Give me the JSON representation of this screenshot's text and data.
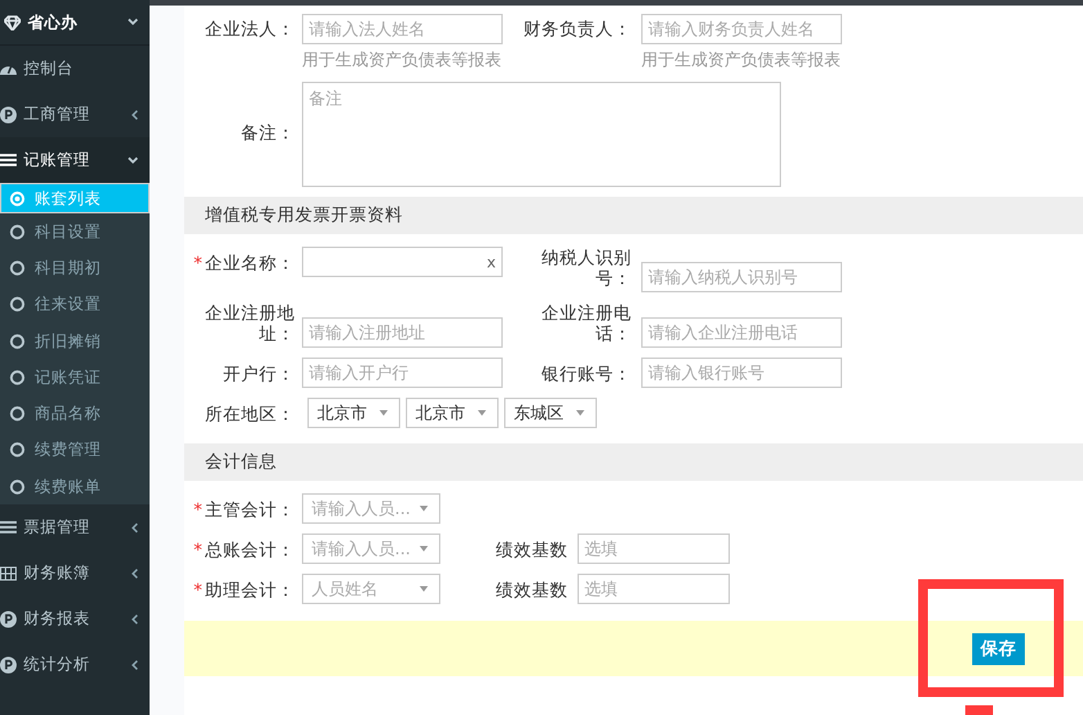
{
  "sidebar": {
    "brand": {
      "label": "省心办",
      "expanded": true
    },
    "items": [
      {
        "label": "控制台",
        "kind": "gauge"
      },
      {
        "label": "工商管理",
        "kind": "badge",
        "expanded": false
      },
      {
        "label": "记账管理",
        "kind": "list",
        "expanded": true,
        "children": [
          {
            "label": "账套列表",
            "selected": true
          },
          {
            "label": "科目设置",
            "selected": false
          },
          {
            "label": "科目期初",
            "selected": false
          },
          {
            "label": "往来设置",
            "selected": false
          },
          {
            "label": "折旧摊销",
            "selected": false
          },
          {
            "label": "记账凭证",
            "selected": false
          },
          {
            "label": "商品名称",
            "selected": false
          },
          {
            "label": "续费管理",
            "selected": false
          },
          {
            "label": "续费账单",
            "selected": false
          }
        ]
      },
      {
        "label": "票据管理",
        "kind": "list",
        "expanded": false
      },
      {
        "label": "财务账簿",
        "kind": "table",
        "expanded": false
      },
      {
        "label": "财务报表",
        "kind": "badge",
        "expanded": false
      },
      {
        "label": "统计分析",
        "kind": "badge",
        "expanded": false
      }
    ]
  },
  "top_fields": [
    {
      "label": "企业法人：",
      "placeholder": "请输入法人姓名",
      "hint": "用于生成资产负债表等报表"
    },
    {
      "label": "财务负责人：",
      "placeholder": "请输入财务负责人姓名",
      "hint": "用于生成资产负债表等报表"
    }
  ],
  "remark": {
    "label": "备注：",
    "placeholder": "备注"
  },
  "sections": [
    {
      "title": "增值税专用发票开票资料",
      "rows": [
        [
          {
            "kind": "input",
            "label": "企业名称：",
            "required": true,
            "clear_button": "x"
          },
          {
            "kind": "input",
            "label": "纳税人识别号：",
            "required": false,
            "placeholder": "请输入纳税人识别号"
          }
        ],
        [
          {
            "kind": "input",
            "label": "企业注册地址：",
            "required": false,
            "placeholder": "请输入注册地址"
          },
          {
            "kind": "input",
            "label": "企业注册电话：",
            "required": false,
            "placeholder": "请输入企业注册电话"
          }
        ],
        [
          {
            "kind": "input",
            "label": "开户行：",
            "required": false,
            "placeholder": "请输入开户行"
          },
          {
            "kind": "input",
            "label": "银行账号：",
            "required": false,
            "placeholder": "请输入银行账号"
          }
        ],
        [
          {
            "kind": "region",
            "label": "所在地区：",
            "required": false,
            "options": [
              "北京市",
              "北京市",
              "东城区"
            ]
          }
        ]
      ]
    },
    {
      "title": "会计信息",
      "rows": [
        [
          {
            "kind": "select",
            "label": "主管会计：",
            "required": true,
            "placeholder": "请输入人员..."
          }
        ],
        [
          {
            "kind": "select",
            "label": "总账会计：",
            "required": true,
            "placeholder": "请输入人员..."
          },
          {
            "kind": "short",
            "label": "绩效基数",
            "required": false,
            "placeholder": "选填"
          }
        ],
        [
          {
            "kind": "select",
            "label": "助理会计：",
            "required": true,
            "placeholder": "人员姓名"
          },
          {
            "kind": "short",
            "label": "绩效基数",
            "required": false,
            "placeholder": "选填"
          }
        ]
      ]
    }
  ],
  "required_mark": "*",
  "save_button": "保存"
}
